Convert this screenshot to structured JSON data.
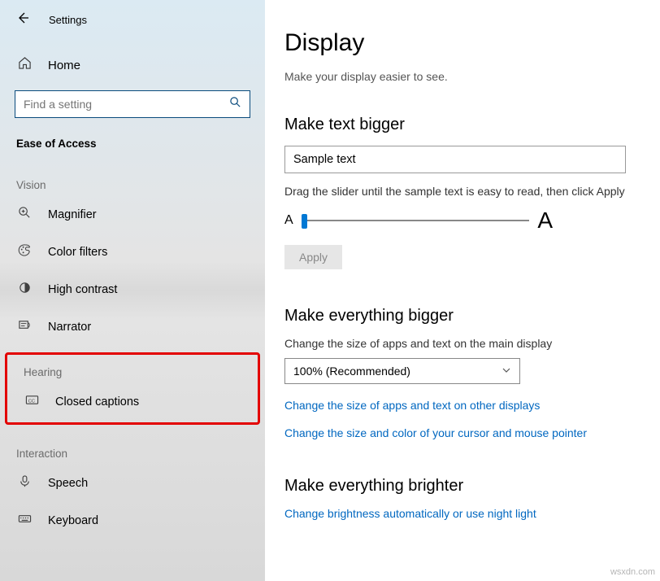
{
  "header": {
    "back": "←",
    "title": "Settings"
  },
  "home": {
    "label": "Home"
  },
  "search": {
    "placeholder": "Find a setting"
  },
  "category": {
    "title": "Ease of Access"
  },
  "groups": {
    "vision": {
      "label": "Vision",
      "items": {
        "magnifier": "Magnifier",
        "color_filters": "Color filters",
        "high_contrast": "High contrast",
        "narrator": "Narrator"
      }
    },
    "hearing": {
      "label": "Hearing",
      "items": {
        "closed_captions": "Closed captions"
      }
    },
    "interaction": {
      "label": "Interaction",
      "items": {
        "speech": "Speech",
        "keyboard": "Keyboard"
      }
    }
  },
  "main": {
    "title": "Display",
    "subtitle": "Make your display easier to see.",
    "text_bigger": {
      "heading": "Make text bigger",
      "sample": "Sample text",
      "slider_desc": "Drag the slider until the sample text is easy to read, then click Apply",
      "a_small": "A",
      "a_large": "A",
      "apply": "Apply"
    },
    "everything_bigger": {
      "heading": "Make everything bigger",
      "desc": "Change the size of apps and text on the main display",
      "dropdown": "100% (Recommended)",
      "link1": "Change the size of apps and text on other displays",
      "link2": "Change the size and color of your cursor and mouse pointer"
    },
    "brighter": {
      "heading": "Make everything brighter",
      "link": "Change brightness automatically or use night light"
    }
  },
  "watermark": "wsxdn.com"
}
